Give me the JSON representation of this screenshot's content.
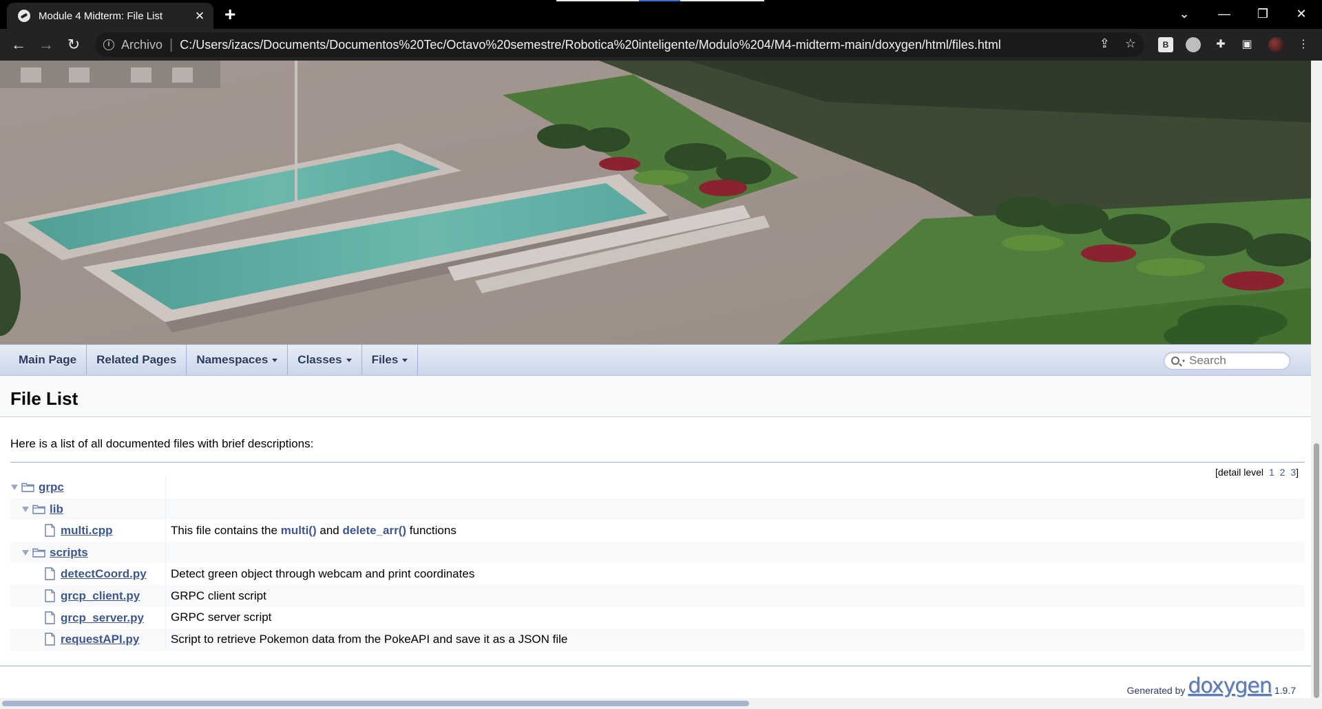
{
  "browser": {
    "tab_title": "Module 4 Midterm: File List",
    "url_scheme_label": "Archivo",
    "url": "C:/Users/izacs/Documents/Documentos%20Tec/Octavo%20semestre/Robotica%20inteligente/Modulo%204/M4-midterm-main/doxygen/html/files.html",
    "extension_b_label": "B"
  },
  "nav": {
    "items": [
      {
        "label": "Main Page",
        "dropdown": false
      },
      {
        "label": "Related Pages",
        "dropdown": false
      },
      {
        "label": "Namespaces",
        "dropdown": true
      },
      {
        "label": "Classes",
        "dropdown": true
      },
      {
        "label": "Files",
        "dropdown": true
      }
    ],
    "search_placeholder": "Search"
  },
  "page": {
    "title": "File List",
    "intro": "Here is a list of all documented files with brief descriptions:",
    "detail_level_prefix": "[detail level",
    "detail_levels": [
      "1",
      "2",
      "3"
    ],
    "detail_level_suffix": "]"
  },
  "tree": [
    {
      "name": "grpc",
      "type": "folder",
      "depth": 0,
      "expanded": true,
      "desc": ""
    },
    {
      "name": "lib",
      "type": "folder",
      "depth": 1,
      "expanded": true,
      "desc": ""
    },
    {
      "name": "multi.cpp",
      "type": "file",
      "depth": 2,
      "desc_parts": [
        "This file contains the ",
        "multi()",
        " and ",
        "delete_arr()",
        " functions"
      ]
    },
    {
      "name": "scripts",
      "type": "folder",
      "depth": 1,
      "expanded": true,
      "desc": ""
    },
    {
      "name": "detectCoord.py",
      "type": "file",
      "depth": 2,
      "desc": "Detect green object through webcam and print coordinates"
    },
    {
      "name": "grcp_client.py",
      "type": "file",
      "depth": 2,
      "desc": "GRPC client script"
    },
    {
      "name": "grcp_server.py",
      "type": "file",
      "depth": 2,
      "desc": "GRPC server script"
    },
    {
      "name": "requestAPI.py",
      "type": "file",
      "depth": 2,
      "desc": "Script to retrieve Pokemon data from the PokeAPI and save it as a JSON file"
    }
  ],
  "footer": {
    "generated_by": "Generated by",
    "logo_text": "doxygen",
    "version": "1.9.7"
  },
  "colors": {
    "link": "#3d578c",
    "nav_text": "#283a5d",
    "nav_border": "#9fb2d6"
  }
}
